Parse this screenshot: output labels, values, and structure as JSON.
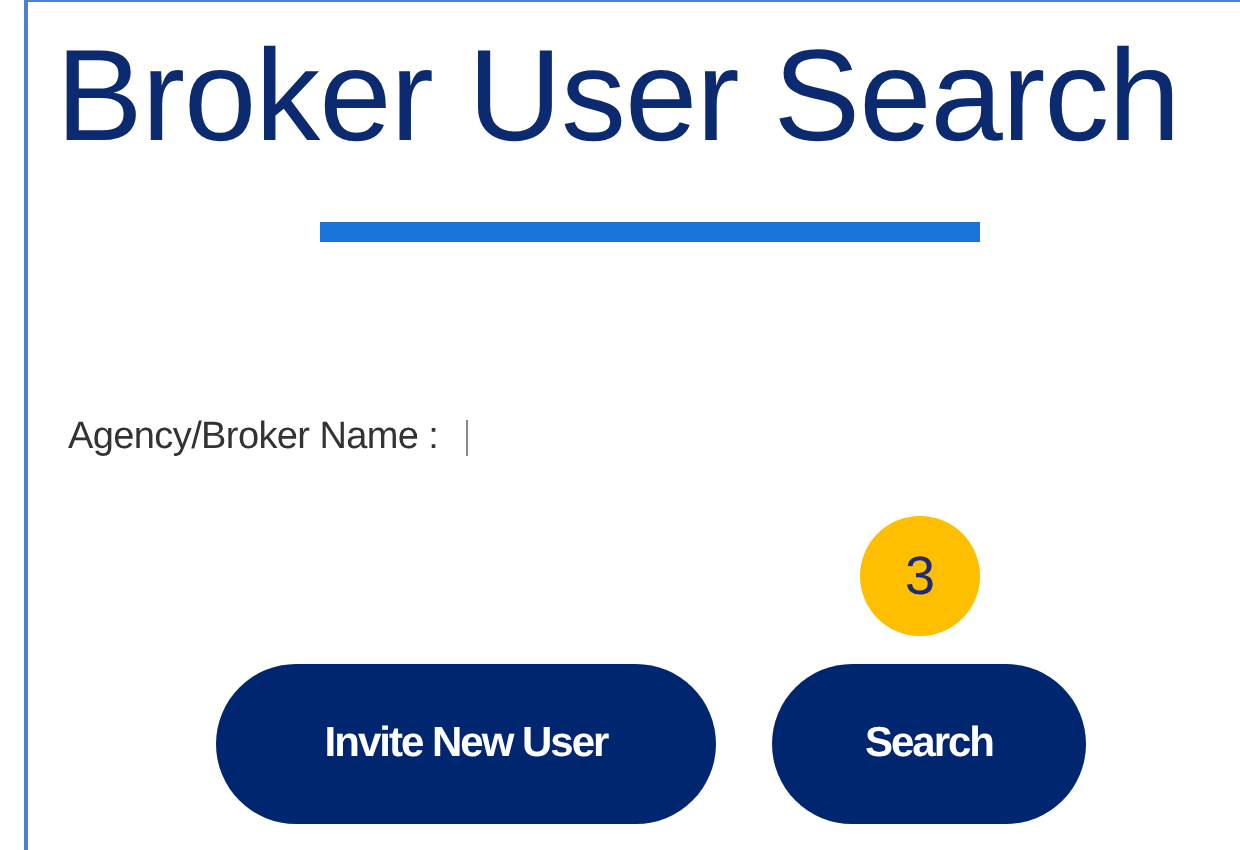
{
  "title": "Broker User Search",
  "field": {
    "label": "Agency/Broker Name :"
  },
  "buttons": [
    {
      "label": "Invite New User"
    },
    {
      "label": "Search",
      "badge": "3"
    }
  ]
}
